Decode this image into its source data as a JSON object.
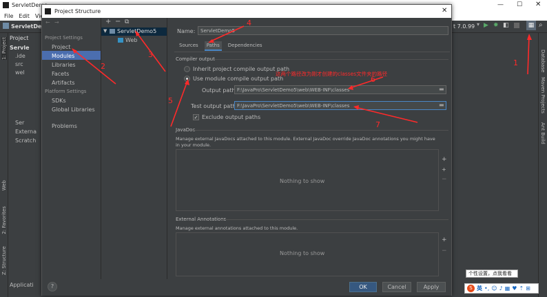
{
  "ide": {
    "title": "ServletDemo",
    "menu": [
      "File",
      "Edit",
      "View"
    ],
    "run_config": "t 7.0.99",
    "project_tree": [
      "ServletDem",
      "Project",
      "Servle",
      ".ide",
      "src",
      "wel",
      "Ser",
      "Externa",
      "Scratch"
    ],
    "left_tabs": [
      "1: Project",
      "Web",
      "2: Favorites",
      "Z: Structure"
    ],
    "right_tabs": [
      "Database",
      "Maven Projects",
      "Ant Build"
    ],
    "status_app": "Applicati"
  },
  "dialog": {
    "title": "Project Structure",
    "nav": {
      "project_settings_header": "Project Settings",
      "project_settings": [
        "Project",
        "Modules",
        "Libraries",
        "Facets",
        "Artifacts"
      ],
      "platform_settings_header": "Platform Settings",
      "platform_settings": [
        "SDKs",
        "Global Libraries"
      ],
      "problems": "Problems"
    },
    "modules": [
      "ServletDemo5",
      "Web"
    ],
    "name_label": "Name:",
    "name_value": "ServletDemo5",
    "tabs": [
      "Sources",
      "Paths",
      "Dependencies"
    ],
    "compiler_output": "Compiler output",
    "radio_inherit": "Inherit project compile output path",
    "radio_use_module": "Use module compile output path",
    "output_path_label": "Output path:",
    "output_path": "F:\\JavaPro\\ServletDemo5\\web\\WEB-INF\\classes",
    "test_output_path_label": "Test output path:",
    "test_output_path": "F:\\JavaPro\\ServletDemo5\\web\\WEB-INF\\classes",
    "exclude_output": "Exclude output paths",
    "javadoc_header": "JavaDoc",
    "javadoc_desc": "Manage external JavaDocs attached to this module. External JavaDoc override JavaDoc annotations you might have in your module.",
    "nothing_to_show": "Nothing to show",
    "ext_annotations_header": "External Annotations",
    "ext_annotations_desc": "Manage external annotations attached to this module.",
    "ok": "OK",
    "cancel": "Cancel",
    "apply": "Apply",
    "help": "?"
  },
  "annotations": {
    "numbers": [
      "1",
      "2",
      "3",
      "4",
      "5",
      "6",
      "7"
    ],
    "note": "这两个路径改为刚才创建的classes文件夹的路径",
    "color": "#ff2a2a"
  },
  "tray": {
    "tooltip": "个性设置，点我看看",
    "ime": "英"
  }
}
